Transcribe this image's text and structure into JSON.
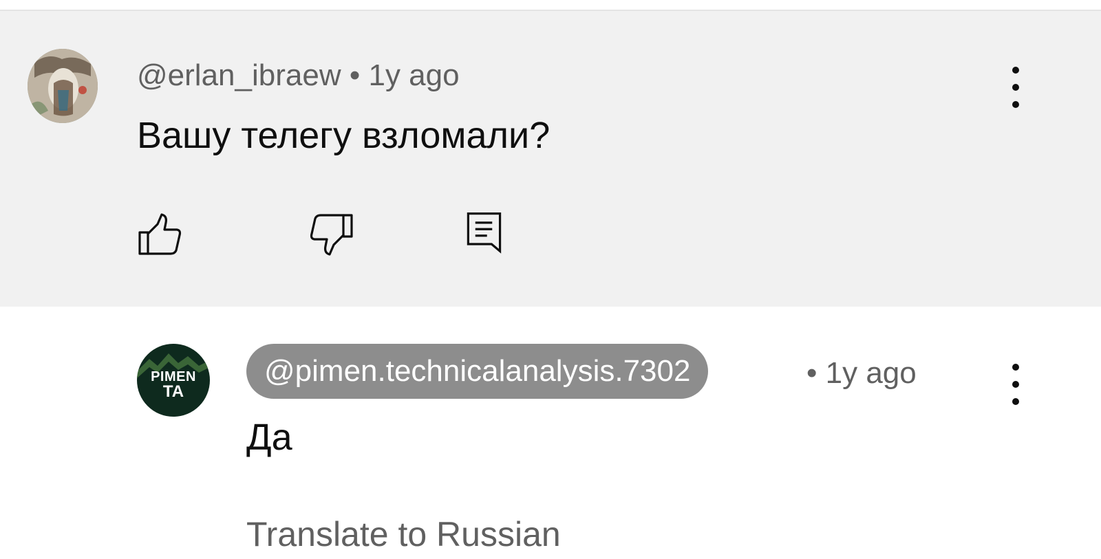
{
  "comment": {
    "author": "@erlan_ibraew",
    "separator": "•",
    "time": "1y ago",
    "text": "Вашу телегу взломали?",
    "actions": {
      "like_icon": "thumbs-up-icon",
      "dislike_icon": "thumbs-down-icon",
      "reply_icon": "reply-icon"
    }
  },
  "reply": {
    "author": "@pimen.technicalanalysis.7302",
    "separator": "•",
    "time": "1y ago",
    "text": "Да",
    "avatar_text_top": "PIMEN",
    "avatar_text_bottom": "TA",
    "translate_label": "Translate to Russian"
  },
  "colors": {
    "comment_background": "#f1f1f1",
    "meta_text": "#606060",
    "body_text": "#0f0f0f",
    "author_chip": "#8d8d8d",
    "reply_avatar": "#0e2a1e"
  }
}
